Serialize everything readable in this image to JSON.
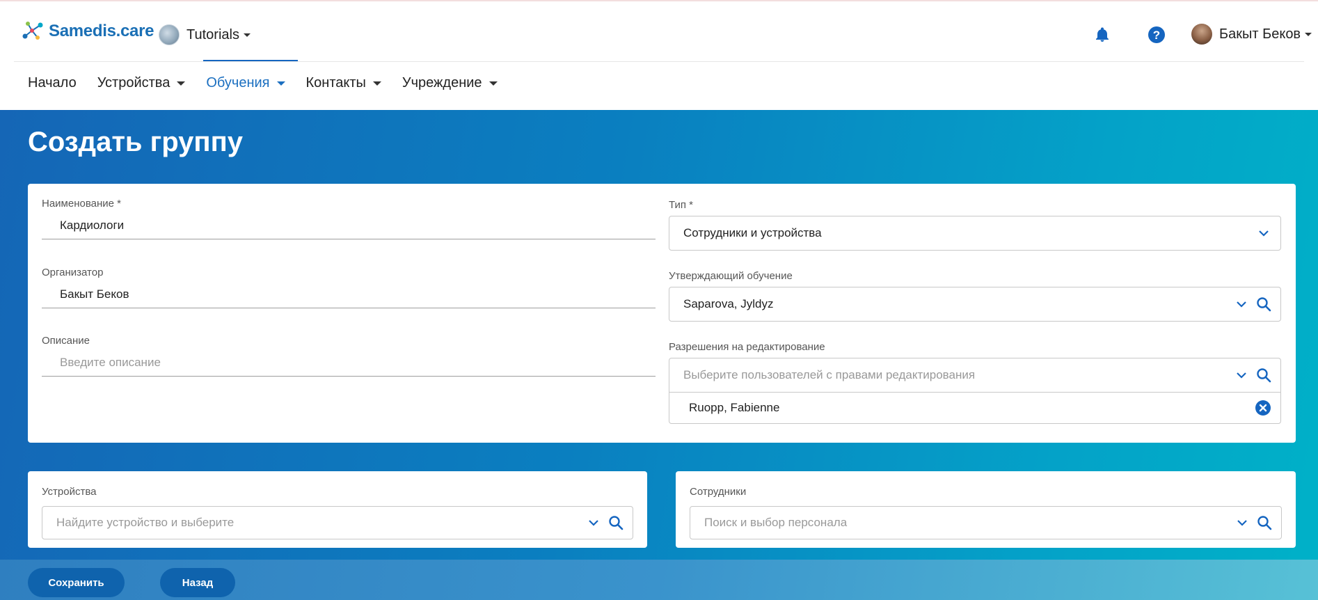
{
  "header": {
    "logo_text": "Samedis",
    "logo_suffix": ".care",
    "tenant": "Tutorials",
    "user": "Бакыт Беков",
    "icons": [
      "notification-bell-icon",
      "help-icon"
    ],
    "accent_color": "#1b6fc0"
  },
  "nav": {
    "items": [
      {
        "label": "Начало"
      },
      {
        "label": "Устройства"
      },
      {
        "label": "Обучения"
      },
      {
        "label": "Контакты"
      },
      {
        "label": "Учреждение"
      }
    ],
    "active": "Обучения"
  },
  "page": {
    "title": "Создать группу"
  },
  "form": {
    "name": {
      "label": "Наименование *",
      "value": "Кардиологи"
    },
    "organizer": {
      "label": "Организатор",
      "value": "Бакыт Беков"
    },
    "description": {
      "label": "Описание",
      "placeholder": "Введите описание"
    },
    "type": {
      "label": "Тип *",
      "value": "Сотрудники и устройства"
    },
    "approver": {
      "label": "Утверждающий обучение",
      "value": "Saparova, Jyldyz"
    },
    "edit_permissions": {
      "label": "Разрешения на редактирование",
      "placeholder": "Выберите пользователей с правами редактирования",
      "selected": [
        "Ruopp, Fabienne"
      ]
    }
  },
  "devices": {
    "label": "Устройства",
    "placeholder": "Найдите устройство и выберите"
  },
  "staff": {
    "label": "Сотрудники",
    "placeholder": "Поиск и выбор персонала"
  },
  "footer": {
    "save_label": "Сохранить",
    "back_label": "Назад"
  }
}
